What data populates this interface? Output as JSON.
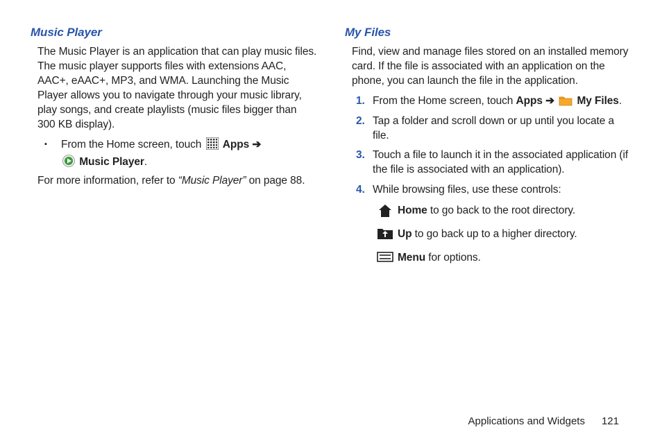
{
  "left": {
    "heading": "Music Player",
    "intro": "The Music Player is an application that can play music files. The music player supports files with extensions AAC, AAC+, eAAC+, MP3, and WMA. Launching the Music Player allows you to navigate through your music library, play songs, and create playlists (music files bigger than 300 KB display).",
    "bullet_pre": "From the Home screen, touch ",
    "apps": "Apps",
    "arrow": "➔",
    "music_player": "Music Player",
    "ref_pre": "For more information, refer to ",
    "ref_quote": "“Music Player”",
    "ref_post": " on page 88."
  },
  "right": {
    "heading": "My Files",
    "intro": "Find, view and manage files stored on an installed memory card. If the file is associated with an application on the phone, you can launch the file in the application.",
    "steps": [
      {
        "n": "1.",
        "pre": "From the Home screen, touch ",
        "apps": "Apps",
        "arrow": "➔",
        "myfiles": "My Files",
        "post": "."
      },
      {
        "n": "2.",
        "text": "Tap a folder and scroll down or up until you locate a file."
      },
      {
        "n": "3.",
        "text": "Touch a file to launch it in the associated application (if the file is associated with an application)."
      },
      {
        "n": "4.",
        "text": "While browsing files, use these controls:"
      }
    ],
    "controls": [
      {
        "b": "Home",
        "rest": " to go back to the root directory."
      },
      {
        "b": "Up",
        "rest": " to go back up to a higher directory."
      },
      {
        "b": "Menu",
        "rest": " for options."
      }
    ]
  },
  "footer": {
    "section": "Applications and Widgets",
    "page": "121"
  }
}
